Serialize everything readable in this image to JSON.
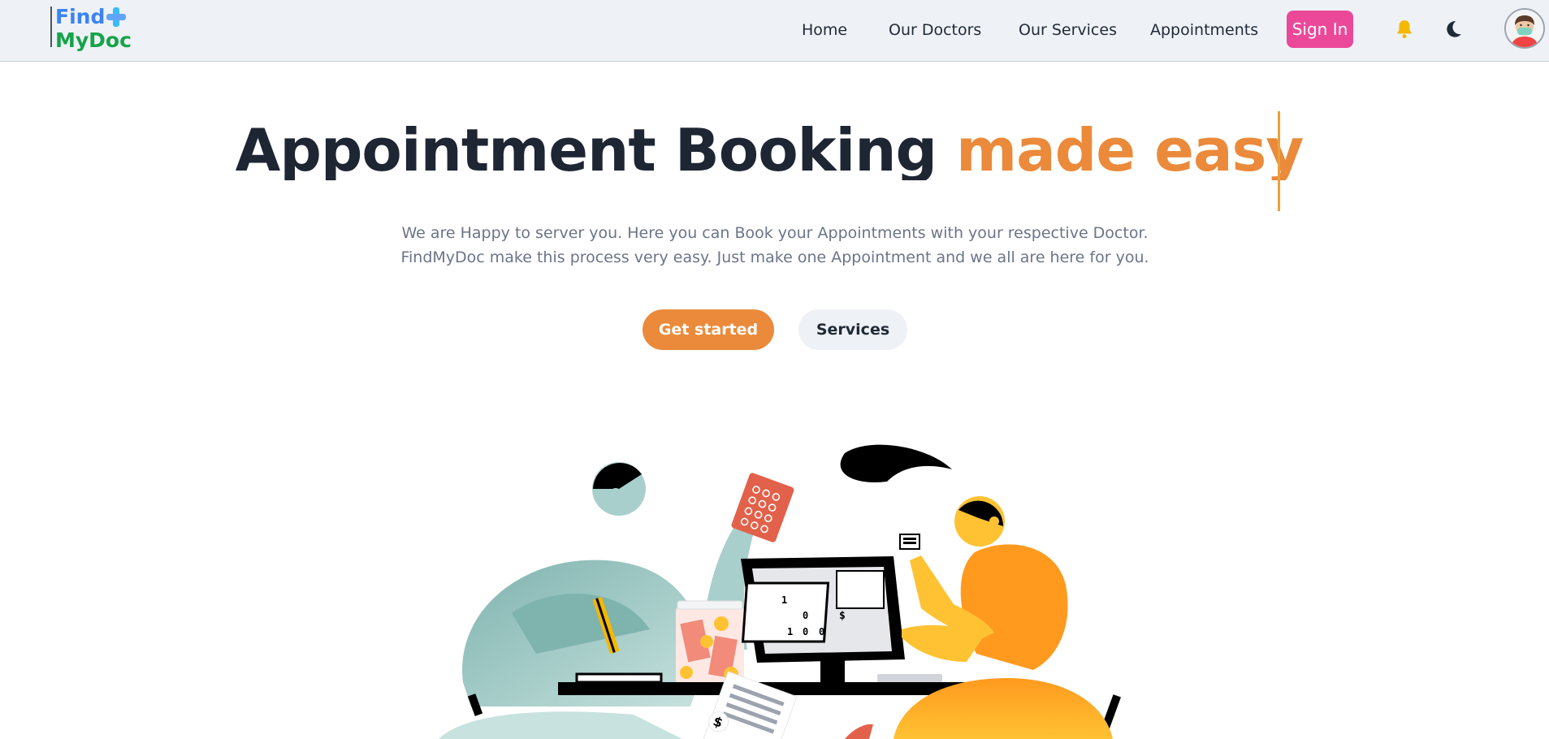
{
  "brand": {
    "line1": "Find",
    "line2": "MyDoc",
    "colors": {
      "find": "#3b82f6",
      "mydoc": "#16a34a"
    }
  },
  "nav": {
    "links": [
      "Home",
      "Our Doctors",
      "Our Services",
      "Appointments"
    ],
    "signin_label": "Sign In",
    "icons": [
      "bell-icon",
      "moon-icon",
      "avatar"
    ]
  },
  "hero": {
    "title_dark": "Appointment Booking",
    "title_accent": "made easy",
    "subtitle": "We are Happy to server you. Here you can Book your Appointments with your respective Doctor. FindMyDoc make this process very easy. Just make one Appointment and we all are here for you.",
    "primary_button": "Get started",
    "secondary_button": "Services"
  },
  "illustration": {
    "monitor_digits": [
      "1",
      "0",
      "$",
      "1",
      "0",
      "0"
    ],
    "receipt_symbol": "$"
  },
  "colors": {
    "accent": "#ea8a3a",
    "signin": "#ec4899",
    "navbar_bg": "#eef2f6",
    "bell": "#f5b700"
  }
}
